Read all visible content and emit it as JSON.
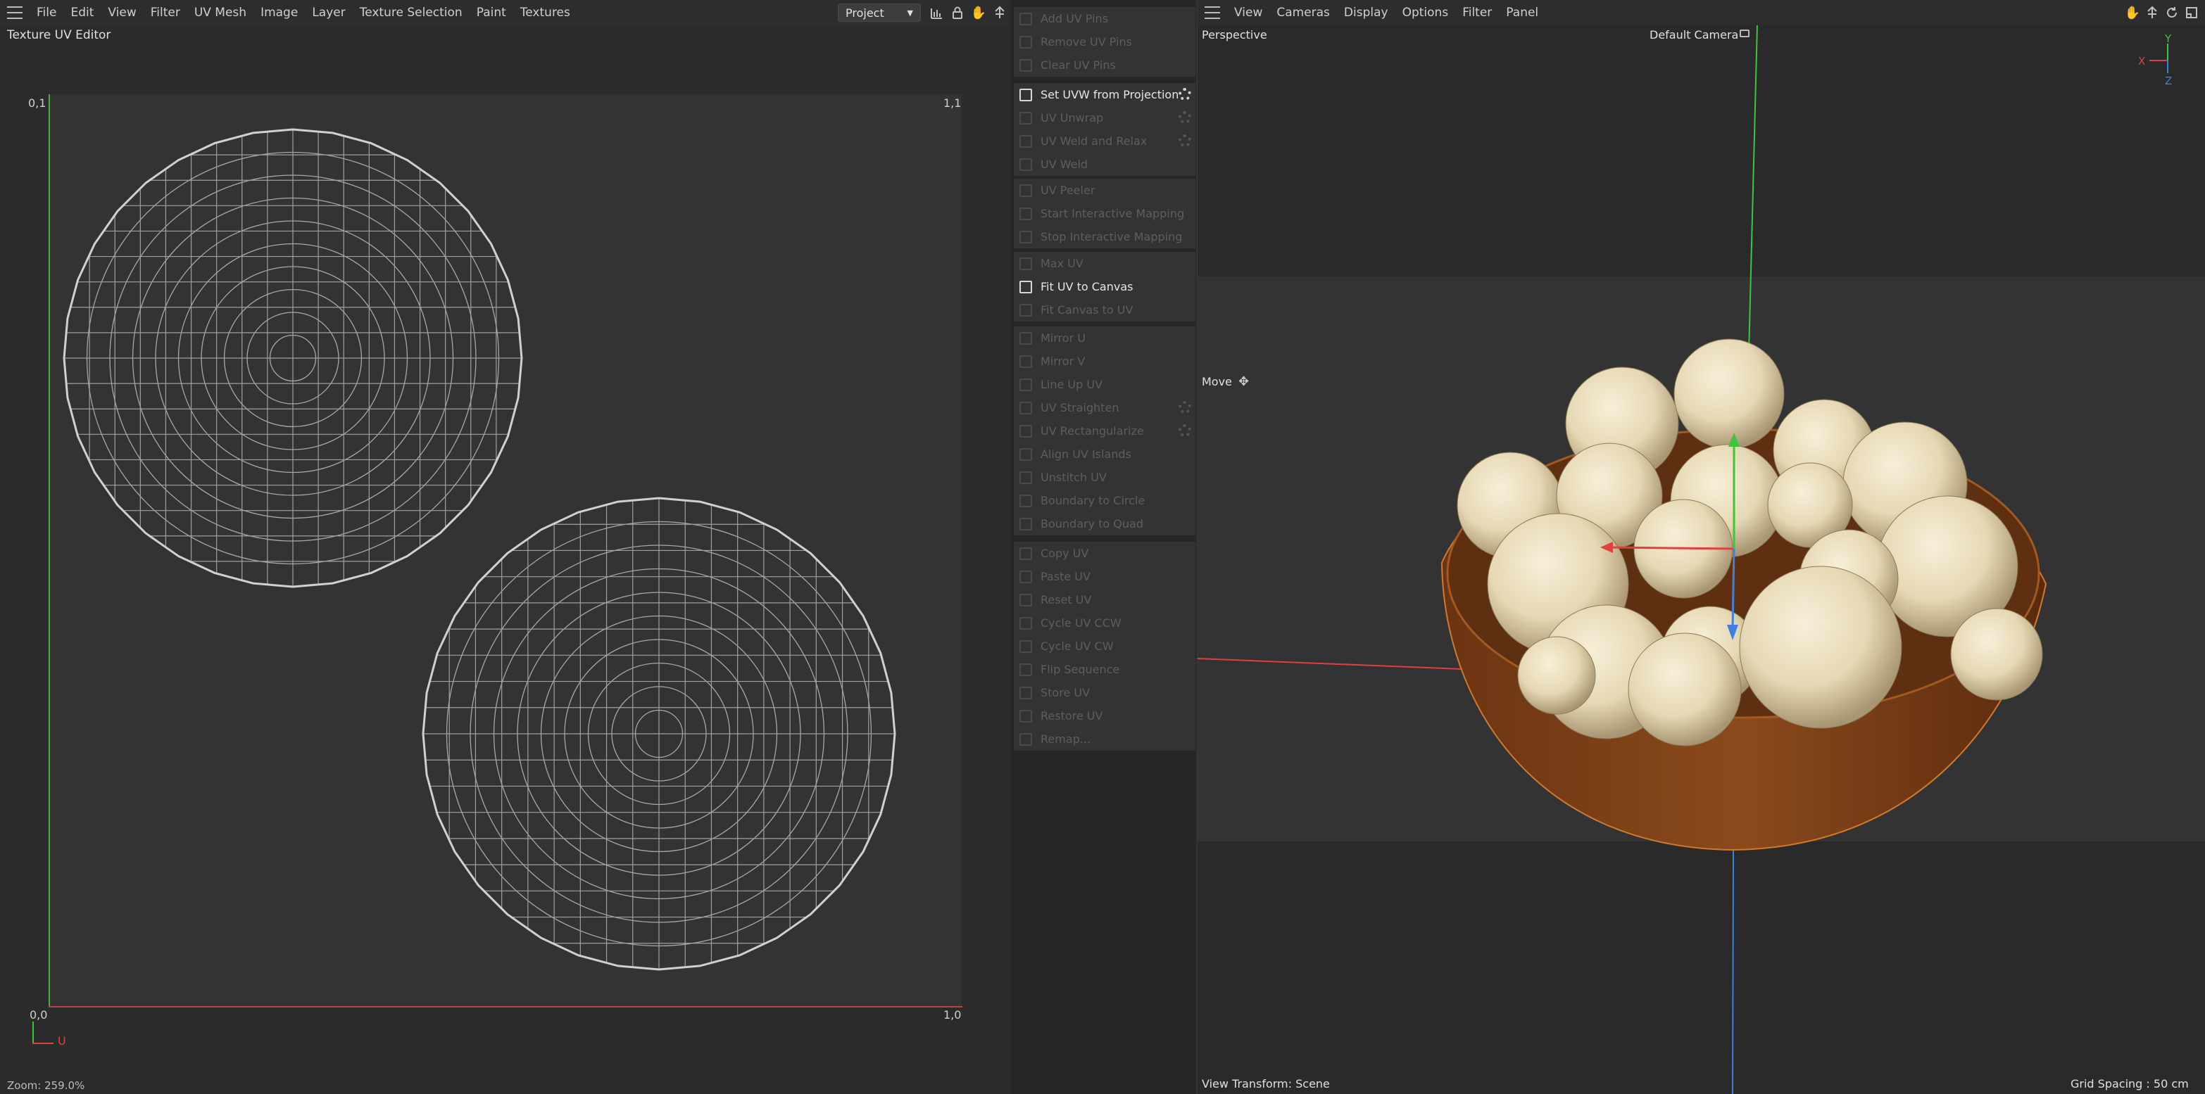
{
  "uv_editor": {
    "menu": [
      "File",
      "Edit",
      "View",
      "Filter",
      "UV Mesh",
      "Image",
      "Layer",
      "Texture Selection",
      "Paint",
      "Textures"
    ],
    "mode_select": "Project",
    "title": "Texture UV Editor",
    "corner_labels": {
      "top_left": "0,1",
      "top_right": "1,1",
      "bottom_left": "0,0",
      "bottom_right": "1,0"
    },
    "axis_u_label": "U",
    "zoom": "Zoom: 259.0%",
    "icons": [
      "graph-icon",
      "lock-icon",
      "hand-icon",
      "move-icon"
    ]
  },
  "commands": {
    "groups": [
      [
        {
          "label": "Add UV Pins",
          "enabled": false,
          "gear": false
        },
        {
          "label": "Remove UV Pins",
          "enabled": false,
          "gear": false
        },
        {
          "label": "Clear UV Pins",
          "enabled": false,
          "gear": false
        }
      ],
      [
        {
          "label": "Set UVW from Projection",
          "enabled": true,
          "gear": true
        },
        {
          "label": "UV Unwrap",
          "enabled": false,
          "gear": true
        },
        {
          "label": "UV Weld and Relax",
          "enabled": false,
          "gear": true
        },
        {
          "label": "UV Weld",
          "enabled": false,
          "gear": false
        }
      ],
      [
        {
          "label": "UV Peeler",
          "enabled": false,
          "gear": false
        },
        {
          "label": "Start Interactive Mapping",
          "enabled": false,
          "gear": false
        },
        {
          "label": "Stop Interactive Mapping",
          "enabled": false,
          "gear": false
        }
      ],
      [
        {
          "label": "Max UV",
          "enabled": false,
          "gear": false
        },
        {
          "label": "Fit UV to Canvas",
          "enabled": true,
          "gear": false
        },
        {
          "label": "Fit Canvas to UV",
          "enabled": false,
          "gear": false
        }
      ],
      [
        {
          "label": "Mirror U",
          "enabled": false,
          "gear": false
        },
        {
          "label": "Mirror V",
          "enabled": false,
          "gear": false
        },
        {
          "label": "Line Up UV",
          "enabled": false,
          "gear": false
        },
        {
          "label": "UV Straighten",
          "enabled": false,
          "gear": true
        },
        {
          "label": "UV Rectangularize",
          "enabled": false,
          "gear": true
        },
        {
          "label": "Align UV Islands",
          "enabled": false,
          "gear": false
        },
        {
          "label": "Unstitch UV",
          "enabled": false,
          "gear": false
        },
        {
          "label": "Boundary to Circle",
          "enabled": false,
          "gear": false
        },
        {
          "label": "Boundary to Quad",
          "enabled": false,
          "gear": false
        }
      ],
      [
        {
          "label": "Copy UV",
          "enabled": false,
          "gear": false
        },
        {
          "label": "Paste UV",
          "enabled": false,
          "gear": false
        },
        {
          "label": "Reset UV",
          "enabled": false,
          "gear": false
        },
        {
          "label": "Cycle UV CCW",
          "enabled": false,
          "gear": false
        },
        {
          "label": "Cycle UV CW",
          "enabled": false,
          "gear": false
        },
        {
          "label": "Flip Sequence",
          "enabled": false,
          "gear": false
        },
        {
          "label": "Store UV",
          "enabled": false,
          "gear": false
        },
        {
          "label": "Restore UV",
          "enabled": false,
          "gear": false
        },
        {
          "label": "Remap...",
          "enabled": false,
          "gear": false
        }
      ]
    ]
  },
  "viewport": {
    "menu": [
      "View",
      "Cameras",
      "Display",
      "Options",
      "Filter",
      "Panel"
    ],
    "name": "Perspective",
    "camera": "Default Camera",
    "tool": "Move",
    "view_transform": "View Transform: Scene",
    "grid_spacing": "Grid Spacing : 50 cm",
    "axis_labels": {
      "x": "X",
      "y": "Y",
      "z": "Z"
    },
    "colors": {
      "x_axis": "#e04040",
      "y_axis": "#3fc43f",
      "z_axis": "#3f7fe0",
      "bowl": "#8a4a1c",
      "nut": "#e6d8b4",
      "wire": "#d0d0d0"
    }
  }
}
